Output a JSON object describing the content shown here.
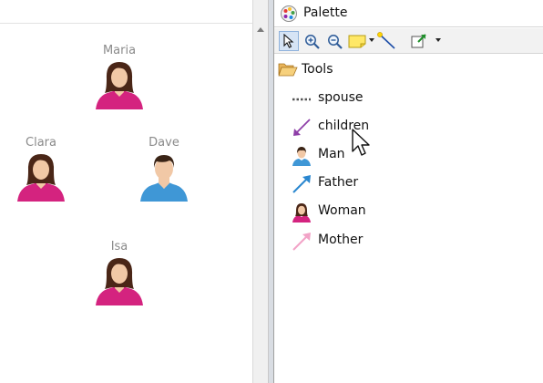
{
  "canvas": {
    "nodes": [
      {
        "label": "Maria",
        "gender": "woman"
      },
      {
        "label": "Clara",
        "gender": "woman"
      },
      {
        "label": "Dave",
        "gender": "man"
      },
      {
        "label": "Isa",
        "gender": "woman"
      }
    ]
  },
  "palette": {
    "title": "Palette",
    "toolbar": {
      "icons": [
        "select-icon",
        "zoom-in-icon",
        "zoom-out-icon",
        "note-icon",
        "connection-icon",
        "template-icon"
      ]
    },
    "drawer": {
      "label": "Tools",
      "items": [
        {
          "label": "spouse",
          "icon": "dotted-line-icon"
        },
        {
          "label": "children",
          "icon": "purple-arrow-icon"
        },
        {
          "label": "Man",
          "icon": "man-icon"
        },
        {
          "label": "Father",
          "icon": "blue-arrow-icon"
        },
        {
          "label": "Woman",
          "icon": "woman-icon"
        },
        {
          "label": "Mother",
          "icon": "pink-arrow-icon"
        }
      ]
    }
  },
  "colors": {
    "woman_shirt": "#d4237f",
    "woman_hair": "#4a2617",
    "man_shirt": "#3f97d6",
    "man_hair": "#3a2416",
    "skin": "#f1c8a6",
    "children_arrow": "#8e3fa8",
    "father_arrow": "#2a87d0",
    "mother_arrow": "#f2a3c7"
  }
}
